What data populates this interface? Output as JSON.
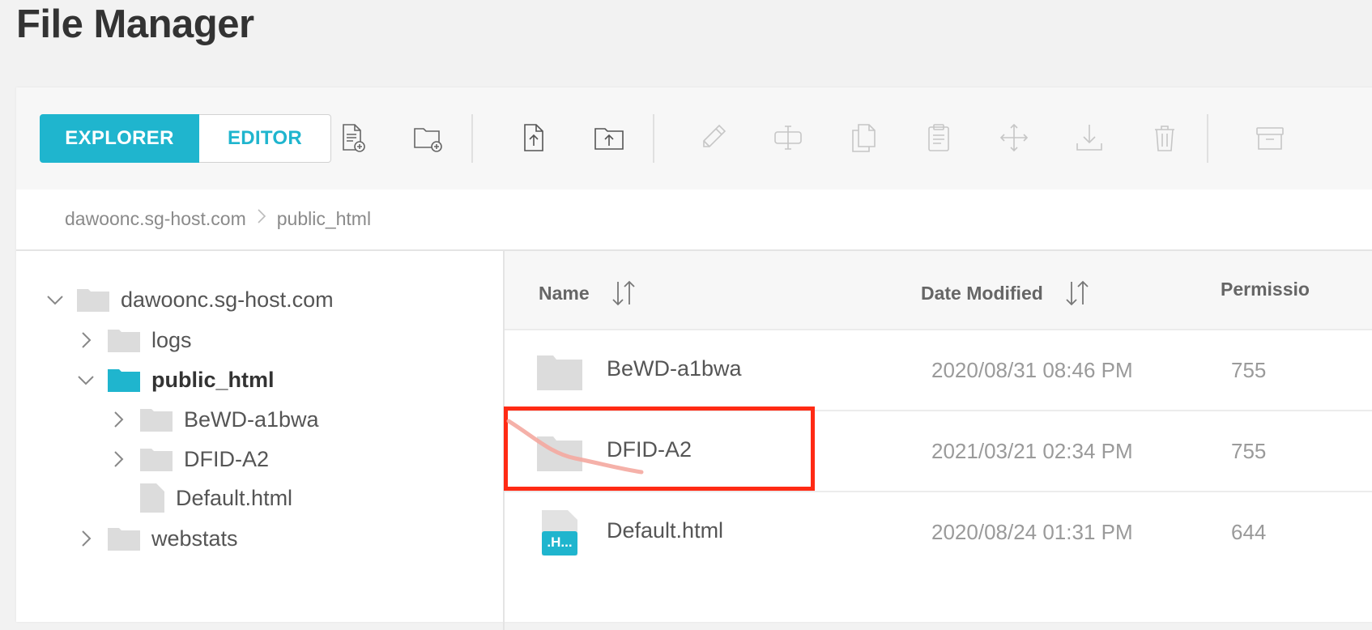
{
  "page": {
    "title": "File Manager"
  },
  "toolbar": {
    "modes": {
      "explorer": "EXPLORER",
      "editor": "EDITOR"
    },
    "icons": [
      "new-file-icon",
      "new-folder-icon",
      "upload-file-icon",
      "upload-folder-icon",
      "edit-icon",
      "rename-icon",
      "copy-icon",
      "paste-icon",
      "move-icon",
      "download-icon",
      "trash-icon",
      "archive-icon"
    ]
  },
  "breadcrumb": {
    "root": "dawoonc.sg-host.com",
    "current": "public_html"
  },
  "tree": {
    "root": "dawoonc.sg-host.com",
    "logs": "logs",
    "public_html": "public_html",
    "bewd": "BeWD-a1bwa",
    "dfid": "DFID-A2",
    "default": "Default.html",
    "webstats": "webstats"
  },
  "list": {
    "headers": {
      "name": "Name",
      "date": "Date Modified",
      "perm": "Permissio"
    },
    "rows": [
      {
        "name": "BeWD-a1bwa",
        "date": "2020/08/31 08:46 PM",
        "perm": "755",
        "type": "folder"
      },
      {
        "name": "DFID-A2",
        "date": "2021/03/21 02:34 PM",
        "perm": "755",
        "type": "folder"
      },
      {
        "name": "Default.html",
        "date": "2020/08/24 01:31 PM",
        "perm": "644",
        "type": "html",
        "badge": ".H..."
      }
    ]
  },
  "colors": {
    "accent": "#1fb5ce",
    "highlight": "#ff2a14",
    "folder": "#dcdcdc"
  }
}
